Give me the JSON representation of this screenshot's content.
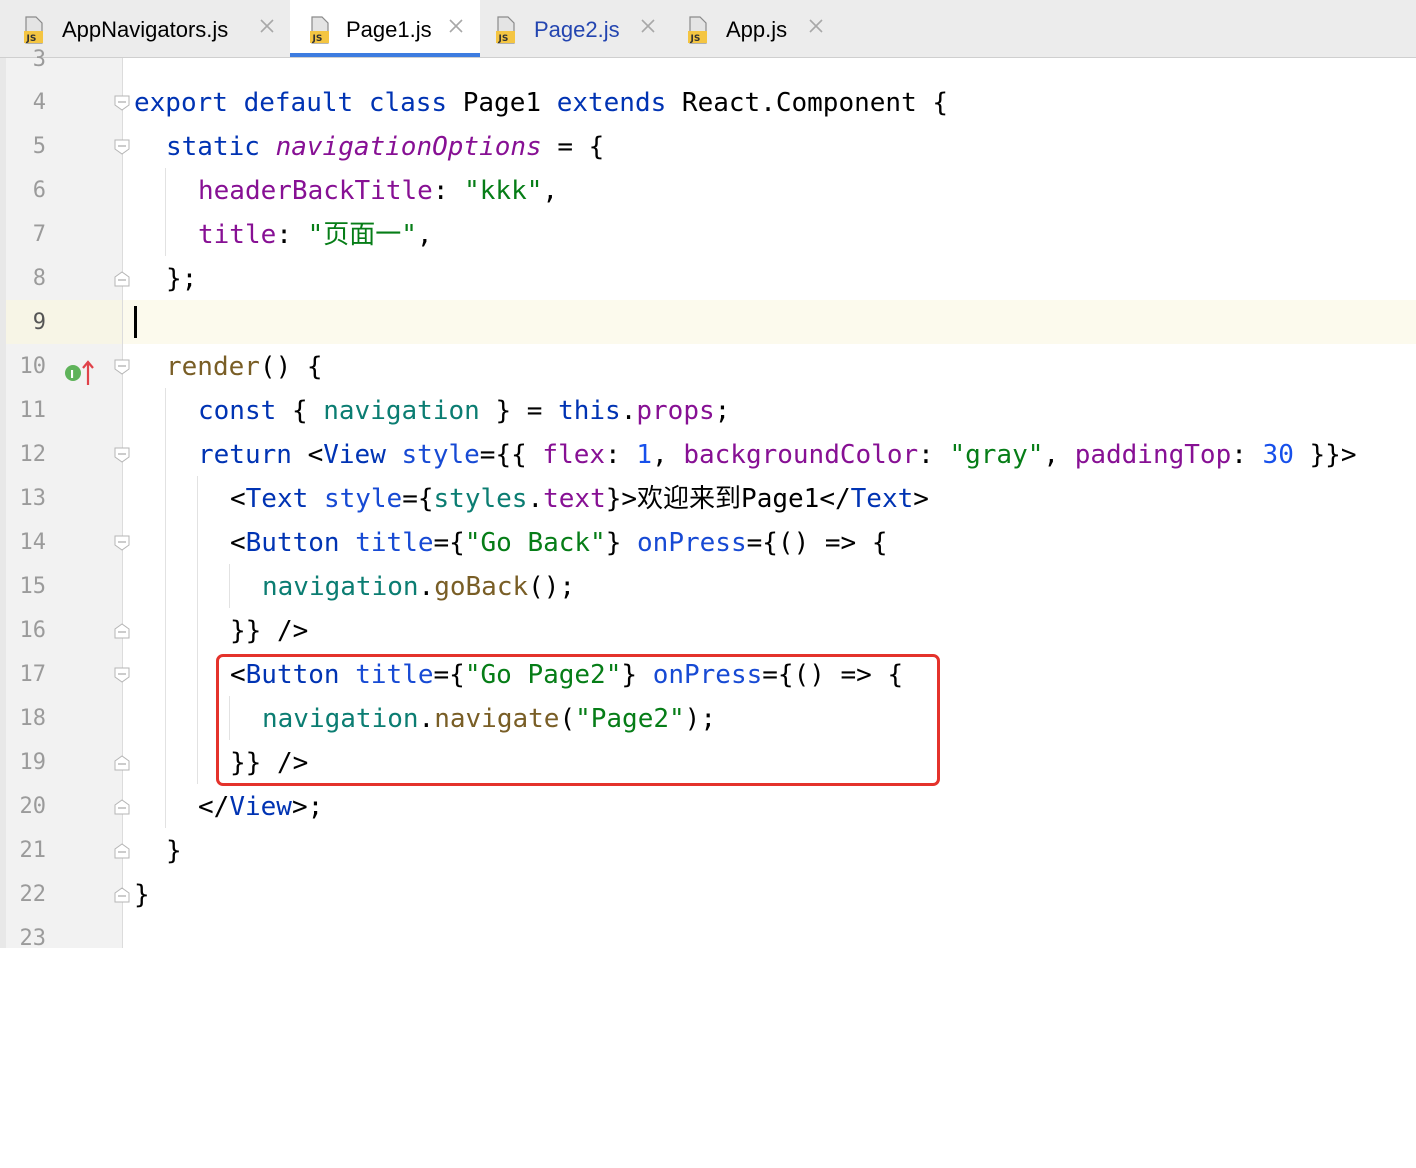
{
  "tabs": [
    {
      "label": "AppNavigators.js",
      "icon": "js-file-icon",
      "active": false,
      "modified": false
    },
    {
      "label": "Page1.js",
      "icon": "js-file-icon",
      "active": true,
      "modified": false
    },
    {
      "label": "Page2.js",
      "icon": "js-file-icon",
      "active": false,
      "modified": true
    },
    {
      "label": "App.js",
      "icon": "js-file-icon",
      "active": false,
      "modified": false
    }
  ],
  "file_icon_text": "JS",
  "editor": {
    "line_numbers": [
      "3",
      "4",
      "5",
      "6",
      "7",
      "8",
      "9",
      "10",
      "11",
      "12",
      "13",
      "14",
      "15",
      "16",
      "17",
      "18",
      "19",
      "20",
      "21",
      "22",
      "23"
    ],
    "current_line": "9",
    "gutter_marker": "implements-method-icon",
    "code": {
      "l4": [
        "export",
        "default",
        "class",
        "Page1",
        "extends",
        "React.Component {"
      ],
      "l5": [
        "static",
        "navigationOptions",
        " = {"
      ],
      "l6": [
        "headerBackTitle",
        ": ",
        "\"kkk\"",
        ","
      ],
      "l7": [
        "title",
        ": ",
        "\"页面一\"",
        ","
      ],
      "l8": "};",
      "l10": [
        "render",
        "() {"
      ],
      "l11": [
        "const",
        "{ ",
        "navigation",
        " } = ",
        "this",
        ".",
        "props",
        ";"
      ],
      "l12": [
        "return",
        " <",
        "View",
        " ",
        "style",
        "={{ ",
        "flex",
        ": ",
        "1",
        ", ",
        "backgroundColor",
        ": ",
        "\"gray\"",
        ", ",
        "paddingTop",
        ": ",
        "30",
        " }}>"
      ],
      "l13": [
        "<",
        "Text",
        " ",
        "style",
        "={",
        "styles",
        ".",
        "text",
        "}>",
        "欢迎来到Page1",
        "</",
        "Text",
        ">"
      ],
      "l14": [
        "<",
        "Button",
        " ",
        "title",
        "={",
        "\"Go Back\"",
        "} ",
        "onPress",
        "={() => {"
      ],
      "l15": [
        "navigation",
        ".",
        "goBack",
        "();"
      ],
      "l16": "}} />",
      "l17": [
        "<",
        "Button",
        " ",
        "title",
        "={",
        "\"Go Page2\"",
        "} ",
        "onPress",
        "={() => {"
      ],
      "l18": [
        "navigation",
        ".",
        "navigate",
        "(",
        "\"Page2\"",
        ");"
      ],
      "l19": "}} />",
      "l20": [
        "</",
        "View",
        ">;"
      ],
      "l21": "}",
      "l22": "}"
    }
  },
  "colors": {
    "keyword": "#0033b3",
    "string": "#067d17",
    "number": "#1750eb",
    "property": "#871094",
    "highlight_box": "#e4322b",
    "active_tab_underline": "#3d7ce0"
  }
}
